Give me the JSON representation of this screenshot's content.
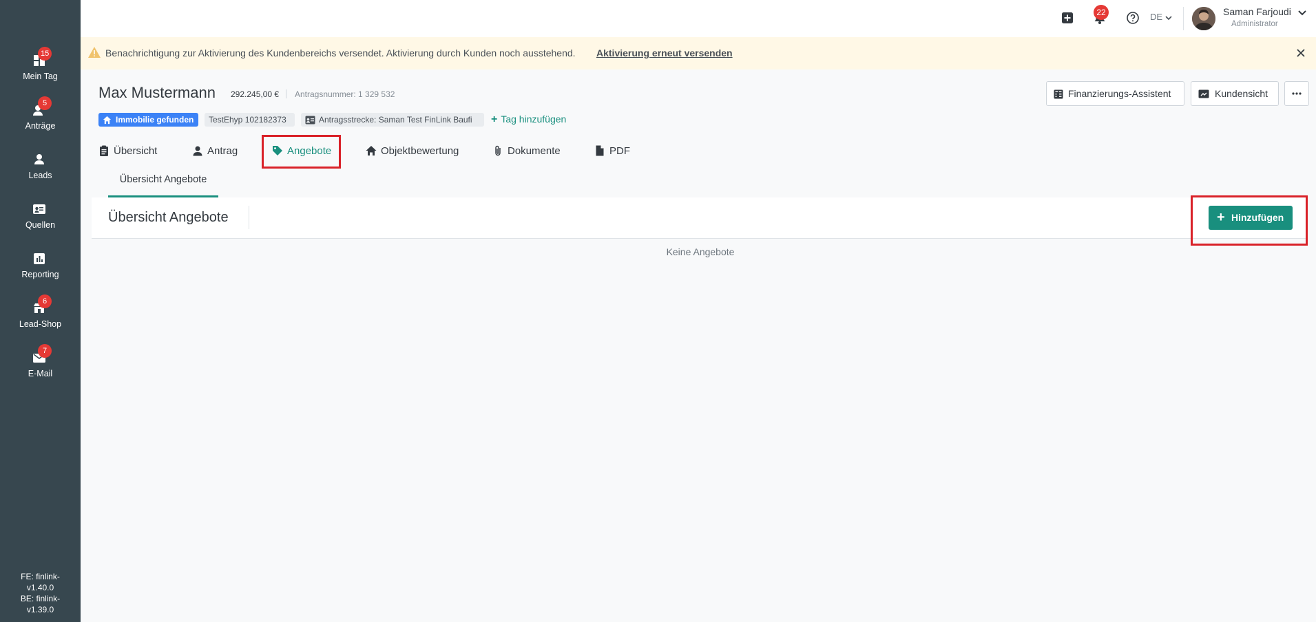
{
  "sidebar": {
    "items": [
      {
        "label": "Mein Tag",
        "badge": "15",
        "icon": "dashboard-icon"
      },
      {
        "label": "Anträge",
        "badge": "5",
        "icon": "users-icon"
      },
      {
        "label": "Leads",
        "badge": "",
        "icon": "user-icon"
      },
      {
        "label": "Quellen",
        "badge": "",
        "icon": "id-card-icon"
      },
      {
        "label": "Reporting",
        "badge": "",
        "icon": "chart-icon"
      },
      {
        "label": "Lead-Shop",
        "badge": "6",
        "icon": "store-icon"
      },
      {
        "label": "E-Mail",
        "badge": "7",
        "icon": "mail-icon"
      }
    ],
    "version_lines": [
      "FE: finlink-",
      "v1.40.0",
      "BE: finlink-",
      "v1.39.0"
    ]
  },
  "topbar": {
    "notifications_count": "22",
    "language": "DE",
    "user_name": "Saman Farjoudi",
    "user_role": "Administrator"
  },
  "alert": {
    "message": "Benachrichtigung zur Aktivierung des Kundenbereichs versendet. Aktivierung durch Kunden noch ausstehend.",
    "link_label": "Aktivierung erneut versenden"
  },
  "header": {
    "name": "Max Mustermann",
    "amount": "292.245,00 €",
    "antragsnummer": "Antragsnummer: 1 329 532",
    "buttons": {
      "finanzierung": "Finanzierungs-Assistent",
      "kundensicht": "Kundensicht",
      "more": "···"
    },
    "tags": {
      "immobilie": "Immobilie gefunden",
      "testehyp": "TestEhyp 102182373",
      "antragsstrecke": "Antragsstrecke: Saman Test FinLink Baufi"
    },
    "add_tag": "Tag hinzufügen"
  },
  "tabs": [
    {
      "label": "Übersicht",
      "icon": "clipboard-icon"
    },
    {
      "label": "Antrag",
      "icon": "person-icon"
    },
    {
      "label": "Angebote",
      "icon": "tag-icon"
    },
    {
      "label": "Objektbewertung",
      "icon": "home-icon"
    },
    {
      "label": "Dokumente",
      "icon": "paperclip-icon"
    },
    {
      "label": "PDF",
      "icon": "file-icon"
    }
  ],
  "subtab": "Übersicht Angebote",
  "card": {
    "title": "Übersicht Angebote",
    "add_button": "Hinzufügen",
    "empty_text": "Keine Angebote"
  },
  "colors": {
    "accent": "#198f7e",
    "sidebar": "#37474f",
    "badge": "#e53935",
    "highlight": "#d92128",
    "tag_blue": "#3b82f6",
    "alert_bg": "#fff8e6"
  }
}
